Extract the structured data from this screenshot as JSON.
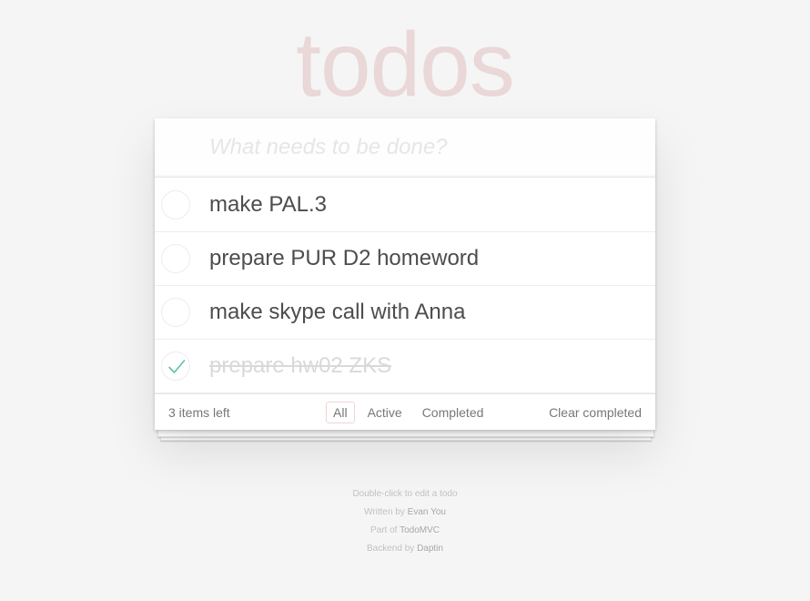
{
  "header": {
    "title": "todos"
  },
  "new_todo": {
    "placeholder": "What needs to be done?",
    "value": ""
  },
  "todos": [
    {
      "title": "make PAL.3",
      "completed": false
    },
    {
      "title": "prepare PUR D2 homeword",
      "completed": false
    },
    {
      "title": "make skype call with Anna",
      "completed": false
    },
    {
      "title": "prepare hw02 ZKS",
      "completed": true
    }
  ],
  "footer": {
    "count_label": "3 items left",
    "filters": [
      {
        "label": "All",
        "selected": true
      },
      {
        "label": "Active",
        "selected": false
      },
      {
        "label": "Completed",
        "selected": false
      }
    ],
    "clear_label": "Clear completed"
  },
  "info": {
    "hint": "Double-click to edit a todo",
    "written_prefix": "Written by",
    "written_author": "Evan You",
    "part_prefix": "Part of",
    "part_link": "TodoMVC",
    "backend_prefix": "Backend by",
    "backend_link": "Daptin"
  },
  "colors": {
    "title": "#af2f2f",
    "checkmark": "#5dc2af",
    "background": "#f5f5f5"
  },
  "icons": {
    "check": "check-icon"
  }
}
